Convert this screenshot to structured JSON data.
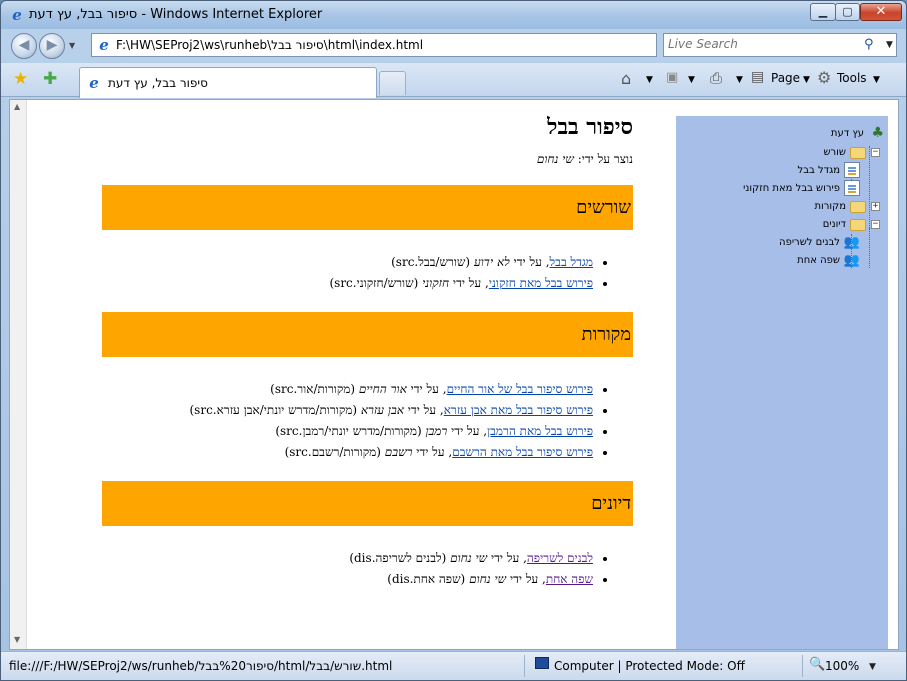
{
  "window": {
    "title": "סיפור בבל, עץ דעת - Windows Internet Explorer"
  },
  "addressbar": {
    "url": "F:\\HW\\SEProj2\\ws\\runheb\\סיפור בבל\\html\\index.html",
    "search_placeholder": "Live Search"
  },
  "tab": {
    "label": "סיפור בבל, עץ דעת"
  },
  "commands": {
    "page": "Page",
    "tools": "Tools"
  },
  "page": {
    "title": "סיפור בבל",
    "creator_prefix": "נוצר על ידי:",
    "creator_name": "שי נחום",
    "by": "על ידי",
    "sections": [
      {
        "heading": "שורשים",
        "items": [
          {
            "link": "מגדל בבל",
            "author": "לא ידוע",
            "path": "(שורש/בבל.src)"
          },
          {
            "link": "פירוש בבל מאת חזקוני",
            "author": "חזקוני",
            "path": "(שורש/חזקוני.src)"
          }
        ]
      },
      {
        "heading": "מקורות",
        "items": [
          {
            "link": "פירוש סיפור בבל של אור החיים",
            "author": "אור החיים",
            "path": "(מקורות/אור.src)"
          },
          {
            "link": "פירוש סיפור בבל מאת אבן עזרא",
            "author": "אבן עזרא",
            "path": "(מקורות/מדרש יונתי/אבן עזרא.src)"
          },
          {
            "link": "פירוש בבל מאת הרמבן",
            "author": "רמבן",
            "path": "(מקורות/מדרש יונתי/רמבן.src)"
          },
          {
            "link": "פירוש סיפור בבל מאת הרשבם",
            "author": "רשבם",
            "path": "(מקורות/רשבם.src)"
          }
        ]
      },
      {
        "heading": "דיונים",
        "items": [
          {
            "link": "לבנים לשריפה",
            "author": "שי נחום",
            "path": "(לבנים לשריפה.dis)"
          },
          {
            "link": "שפה אחת",
            "author": "שי נחום",
            "path": "(שפה אחת.dis)"
          }
        ]
      }
    ]
  },
  "tree": {
    "root": "עץ דעת",
    "nodes": {
      "roots": "שורש",
      "babel_tower": "מגדל בבל",
      "chizkuni": "פירוש בבל מאת חזקוני",
      "sources": "מקורות",
      "discussions": "דיונים",
      "bricks": "לבנים לשריפה",
      "one_language": "שפה אחת"
    }
  },
  "status": {
    "url": "file:///F:/HW/SEProj2/ws/runheb/סיפור%20בבל/html/שורש/בבל.html",
    "zone": "Computer | Protected Mode: Off",
    "zoom": "100%"
  }
}
